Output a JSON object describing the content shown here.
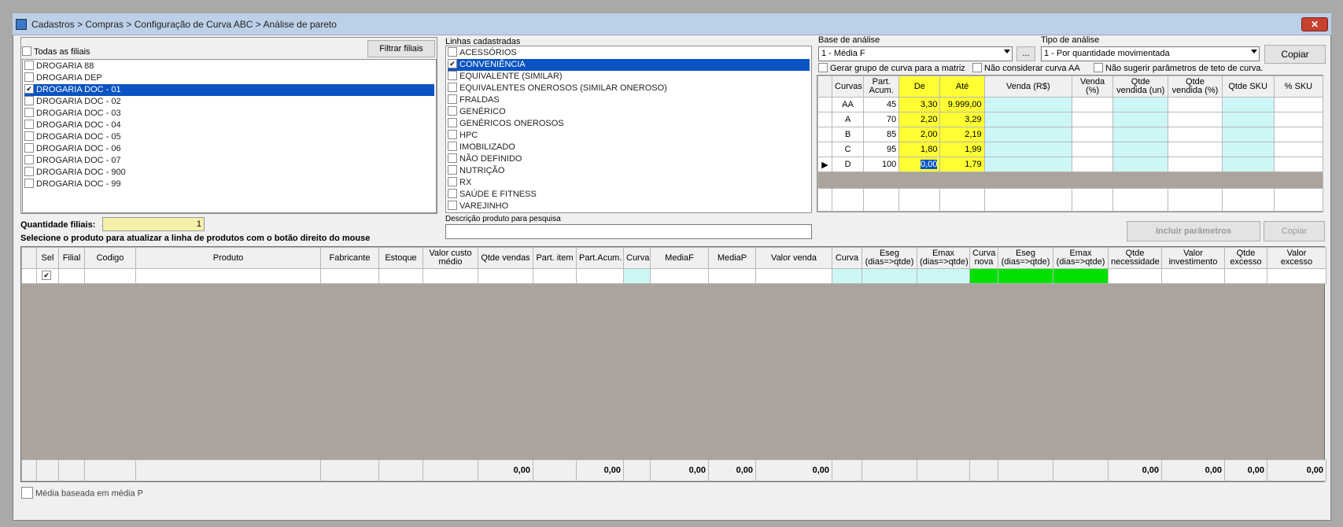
{
  "window": {
    "title": "Cadastros > Compras > Configuração de Curva ABC > Análise de pareto",
    "close_label": "✕"
  },
  "filiais": {
    "todas_label": "Todas as filiais",
    "filtrar_label": "Filtrar filiais",
    "items": [
      {
        "label": "DROGARIA 88",
        "checked": false,
        "selected": false
      },
      {
        "label": "DROGARIA DEP",
        "checked": false,
        "selected": false
      },
      {
        "label": "DROGARIA DOC - 01",
        "checked": true,
        "selected": true
      },
      {
        "label": "DROGARIA DOC - 02",
        "checked": false,
        "selected": false
      },
      {
        "label": "DROGARIA DOC - 03",
        "checked": false,
        "selected": false
      },
      {
        "label": "DROGARIA DOC - 04",
        "checked": false,
        "selected": false
      },
      {
        "label": "DROGARIA DOC - 05",
        "checked": false,
        "selected": false
      },
      {
        "label": "DROGARIA DOC - 06",
        "checked": false,
        "selected": false
      },
      {
        "label": "DROGARIA DOC - 07",
        "checked": false,
        "selected": false
      },
      {
        "label": "DROGARIA DOC - 900",
        "checked": false,
        "selected": false
      },
      {
        "label": "DROGARIA DOC - 99",
        "checked": false,
        "selected": false
      }
    ],
    "quantidade_label": "Quantidade filiais:",
    "quantidade_value": "1",
    "instrucao": "Selecione o produto para atualizar a linha de produtos com o botão direito do mouse"
  },
  "linhas": {
    "label": "Linhas cadastradas",
    "items": [
      {
        "label": "ACESSÓRIOS",
        "checked": false,
        "selected": false
      },
      {
        "label": "CONVENIÊNCIA",
        "checked": true,
        "selected": true
      },
      {
        "label": "EQUIVALENTE (SIMILAR)",
        "checked": false,
        "selected": false
      },
      {
        "label": "EQUIVALENTES ONEROSOS (SIMILAR ONEROSO)",
        "checked": false,
        "selected": false
      },
      {
        "label": "FRALDAS",
        "checked": false,
        "selected": false
      },
      {
        "label": "GENÉRICO",
        "checked": false,
        "selected": false
      },
      {
        "label": "GENÉRICOS ONEROSOS",
        "checked": false,
        "selected": false
      },
      {
        "label": "HPC",
        "checked": false,
        "selected": false
      },
      {
        "label": "IMOBILIZADO",
        "checked": false,
        "selected": false
      },
      {
        "label": "NÃO DEFINIDO",
        "checked": false,
        "selected": false
      },
      {
        "label": "NUTRIÇÃO",
        "checked": false,
        "selected": false
      },
      {
        "label": "RX",
        "checked": false,
        "selected": false
      },
      {
        "label": "SAÚDE E FITNESS",
        "checked": false,
        "selected": false
      },
      {
        "label": "VAREJINHO",
        "checked": false,
        "selected": false
      }
    ],
    "descricao_label": "Descrição produto para pesquisa",
    "descricao_value": ""
  },
  "analise": {
    "base_label": "Base de análise",
    "base_value": "1 - Média F",
    "ellipsis": "...",
    "tipo_label": "Tipo de análise",
    "tipo_value": "1 - Por quantidade movimentada",
    "copiar_label": "Copiar",
    "opt_gerar": "Gerar grupo de curva para a matriz",
    "opt_nao_considerar": "Não considerar curva AA",
    "opt_nao_sugerir": "Não sugerir parâmetros de teto de curva.",
    "incluir_label": "Incluir parâmetros",
    "copiar2_label": "Copiar"
  },
  "curvas": {
    "headers": [
      "Curvas",
      "Part. Acum.",
      "De",
      "Até",
      "Venda (R$)",
      "Venda (%)",
      "Qtde vendida (un)",
      "Qtde vendida (%)",
      "Qtde SKU",
      "% SKU"
    ],
    "rows": [
      {
        "curva": "AA",
        "part": "45",
        "de": "3,30",
        "ate": "9.999,00",
        "current": false
      },
      {
        "curva": "A",
        "part": "70",
        "de": "2,20",
        "ate": "3,29",
        "current": false
      },
      {
        "curva": "B",
        "part": "85",
        "de": "2,00",
        "ate": "2,19",
        "current": false
      },
      {
        "curva": "C",
        "part": "95",
        "de": "1,80",
        "ate": "1,99",
        "current": false
      },
      {
        "curva": "D",
        "part": "100",
        "de": "0,00",
        "ate": "1,79",
        "current": true
      }
    ]
  },
  "produtos": {
    "headers": [
      "Sel",
      "Filial",
      "Codigo",
      "Produto",
      "Fabricante",
      "Estoque",
      "Valor custo médio",
      "Qtde vendas",
      "Part. item",
      "Part.Acum.",
      "Curva",
      "MediaF",
      "MediaP",
      "Valor venda",
      "Curva",
      "Eseg (dias=>qtde)",
      "Emax (dias=>qtde)",
      "Curva nova",
      "Eseg (dias=>qtde)",
      "Emax (dias=>qtde)",
      "Qtde necessidade",
      "Valor investimento",
      "Qtde excesso",
      "Valor excesso"
    ],
    "totals": [
      "",
      "",
      "",
      "",
      "",
      "",
      "",
      "0,00",
      "",
      "0,00",
      "",
      "0,00",
      "0,00",
      "0,00",
      "",
      "",
      "",
      "",
      "",
      "",
      "0,00",
      "0,00",
      "0,00",
      "0,00"
    ],
    "media_p_label": "Média baseada em média P"
  }
}
